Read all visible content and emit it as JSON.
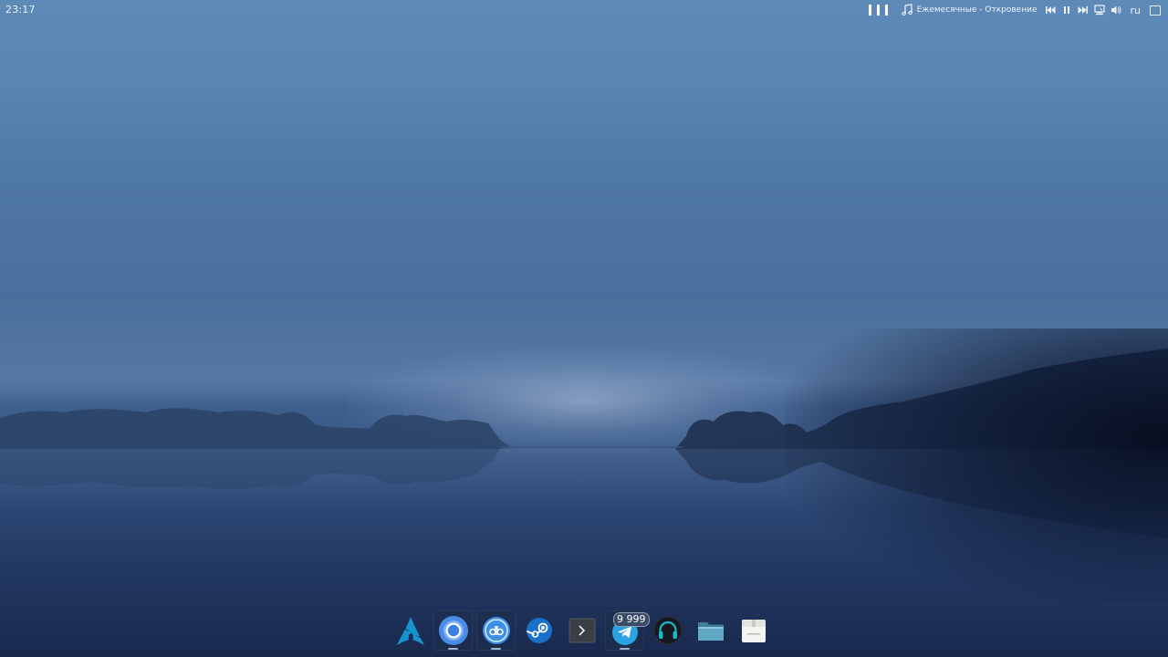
{
  "top_panel": {
    "clock": "23:17",
    "now_playing": "Ежемесячные - Откровение",
    "keyboard_layout": "ru",
    "icons": [
      "workspace-bars-icon",
      "music-note-icon",
      "previous-track-icon",
      "pause-icon",
      "next-track-icon",
      "network-icon",
      "volume-icon",
      "show-desktop-icon"
    ]
  },
  "dock": {
    "items": [
      {
        "name": "arch-linux",
        "icon": "arch-logo-icon",
        "active": false,
        "running": false
      },
      {
        "name": "chromium",
        "icon": "chromium-icon",
        "active": true,
        "running": true
      },
      {
        "name": "qbittorrent",
        "icon": "qbittorrent-icon",
        "active": true,
        "running": true
      },
      {
        "name": "steam",
        "icon": "steam-icon",
        "active": false,
        "running": false
      },
      {
        "name": "terminal",
        "icon": "terminal-icon",
        "active": false,
        "running": false
      },
      {
        "name": "telegram",
        "icon": "telegram-icon",
        "active": true,
        "running": true,
        "badge": "9 999"
      },
      {
        "name": "headphones-player",
        "icon": "headphones-icon",
        "active": false,
        "running": false
      },
      {
        "name": "file-manager",
        "icon": "folder-icon",
        "active": false,
        "running": false
      },
      {
        "name": "archive-manager",
        "icon": "package-icon",
        "active": false,
        "running": false
      }
    ]
  },
  "colors": {
    "sky_top": "#5e8ab8",
    "water_bottom": "#1c2f58",
    "accent_blue": "#3d8fe6"
  }
}
